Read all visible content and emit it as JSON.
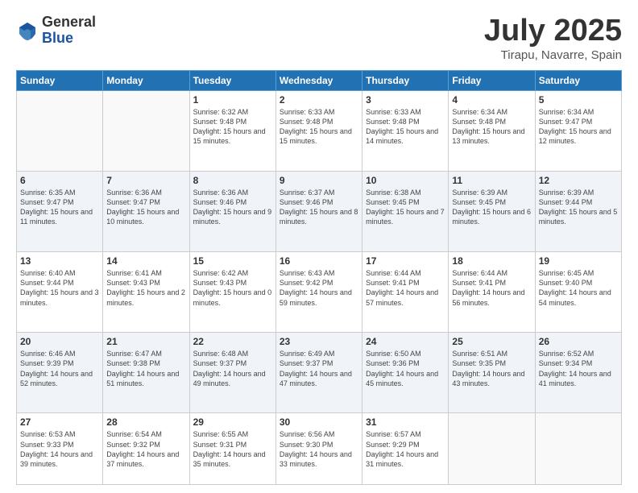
{
  "logo": {
    "general": "General",
    "blue": "Blue"
  },
  "title": "July 2025",
  "subtitle": "Tirapu, Navarre, Spain",
  "weekdays": [
    "Sunday",
    "Monday",
    "Tuesday",
    "Wednesday",
    "Thursday",
    "Friday",
    "Saturday"
  ],
  "weeks": [
    [
      {
        "day": "",
        "sunrise": "",
        "sunset": "",
        "daylight": ""
      },
      {
        "day": "",
        "sunrise": "",
        "sunset": "",
        "daylight": ""
      },
      {
        "day": "1",
        "sunrise": "Sunrise: 6:32 AM",
        "sunset": "Sunset: 9:48 PM",
        "daylight": "Daylight: 15 hours and 15 minutes."
      },
      {
        "day": "2",
        "sunrise": "Sunrise: 6:33 AM",
        "sunset": "Sunset: 9:48 PM",
        "daylight": "Daylight: 15 hours and 15 minutes."
      },
      {
        "day": "3",
        "sunrise": "Sunrise: 6:33 AM",
        "sunset": "Sunset: 9:48 PM",
        "daylight": "Daylight: 15 hours and 14 minutes."
      },
      {
        "day": "4",
        "sunrise": "Sunrise: 6:34 AM",
        "sunset": "Sunset: 9:48 PM",
        "daylight": "Daylight: 15 hours and 13 minutes."
      },
      {
        "day": "5",
        "sunrise": "Sunrise: 6:34 AM",
        "sunset": "Sunset: 9:47 PM",
        "daylight": "Daylight: 15 hours and 12 minutes."
      }
    ],
    [
      {
        "day": "6",
        "sunrise": "Sunrise: 6:35 AM",
        "sunset": "Sunset: 9:47 PM",
        "daylight": "Daylight: 15 hours and 11 minutes."
      },
      {
        "day": "7",
        "sunrise": "Sunrise: 6:36 AM",
        "sunset": "Sunset: 9:47 PM",
        "daylight": "Daylight: 15 hours and 10 minutes."
      },
      {
        "day": "8",
        "sunrise": "Sunrise: 6:36 AM",
        "sunset": "Sunset: 9:46 PM",
        "daylight": "Daylight: 15 hours and 9 minutes."
      },
      {
        "day": "9",
        "sunrise": "Sunrise: 6:37 AM",
        "sunset": "Sunset: 9:46 PM",
        "daylight": "Daylight: 15 hours and 8 minutes."
      },
      {
        "day": "10",
        "sunrise": "Sunrise: 6:38 AM",
        "sunset": "Sunset: 9:45 PM",
        "daylight": "Daylight: 15 hours and 7 minutes."
      },
      {
        "day": "11",
        "sunrise": "Sunrise: 6:39 AM",
        "sunset": "Sunset: 9:45 PM",
        "daylight": "Daylight: 15 hours and 6 minutes."
      },
      {
        "day": "12",
        "sunrise": "Sunrise: 6:39 AM",
        "sunset": "Sunset: 9:44 PM",
        "daylight": "Daylight: 15 hours and 5 minutes."
      }
    ],
    [
      {
        "day": "13",
        "sunrise": "Sunrise: 6:40 AM",
        "sunset": "Sunset: 9:44 PM",
        "daylight": "Daylight: 15 hours and 3 minutes."
      },
      {
        "day": "14",
        "sunrise": "Sunrise: 6:41 AM",
        "sunset": "Sunset: 9:43 PM",
        "daylight": "Daylight: 15 hours and 2 minutes."
      },
      {
        "day": "15",
        "sunrise": "Sunrise: 6:42 AM",
        "sunset": "Sunset: 9:43 PM",
        "daylight": "Daylight: 15 hours and 0 minutes."
      },
      {
        "day": "16",
        "sunrise": "Sunrise: 6:43 AM",
        "sunset": "Sunset: 9:42 PM",
        "daylight": "Daylight: 14 hours and 59 minutes."
      },
      {
        "day": "17",
        "sunrise": "Sunrise: 6:44 AM",
        "sunset": "Sunset: 9:41 PM",
        "daylight": "Daylight: 14 hours and 57 minutes."
      },
      {
        "day": "18",
        "sunrise": "Sunrise: 6:44 AM",
        "sunset": "Sunset: 9:41 PM",
        "daylight": "Daylight: 14 hours and 56 minutes."
      },
      {
        "day": "19",
        "sunrise": "Sunrise: 6:45 AM",
        "sunset": "Sunset: 9:40 PM",
        "daylight": "Daylight: 14 hours and 54 minutes."
      }
    ],
    [
      {
        "day": "20",
        "sunrise": "Sunrise: 6:46 AM",
        "sunset": "Sunset: 9:39 PM",
        "daylight": "Daylight: 14 hours and 52 minutes."
      },
      {
        "day": "21",
        "sunrise": "Sunrise: 6:47 AM",
        "sunset": "Sunset: 9:38 PM",
        "daylight": "Daylight: 14 hours and 51 minutes."
      },
      {
        "day": "22",
        "sunrise": "Sunrise: 6:48 AM",
        "sunset": "Sunset: 9:37 PM",
        "daylight": "Daylight: 14 hours and 49 minutes."
      },
      {
        "day": "23",
        "sunrise": "Sunrise: 6:49 AM",
        "sunset": "Sunset: 9:37 PM",
        "daylight": "Daylight: 14 hours and 47 minutes."
      },
      {
        "day": "24",
        "sunrise": "Sunrise: 6:50 AM",
        "sunset": "Sunset: 9:36 PM",
        "daylight": "Daylight: 14 hours and 45 minutes."
      },
      {
        "day": "25",
        "sunrise": "Sunrise: 6:51 AM",
        "sunset": "Sunset: 9:35 PM",
        "daylight": "Daylight: 14 hours and 43 minutes."
      },
      {
        "day": "26",
        "sunrise": "Sunrise: 6:52 AM",
        "sunset": "Sunset: 9:34 PM",
        "daylight": "Daylight: 14 hours and 41 minutes."
      }
    ],
    [
      {
        "day": "27",
        "sunrise": "Sunrise: 6:53 AM",
        "sunset": "Sunset: 9:33 PM",
        "daylight": "Daylight: 14 hours and 39 minutes."
      },
      {
        "day": "28",
        "sunrise": "Sunrise: 6:54 AM",
        "sunset": "Sunset: 9:32 PM",
        "daylight": "Daylight: 14 hours and 37 minutes."
      },
      {
        "day": "29",
        "sunrise": "Sunrise: 6:55 AM",
        "sunset": "Sunset: 9:31 PM",
        "daylight": "Daylight: 14 hours and 35 minutes."
      },
      {
        "day": "30",
        "sunrise": "Sunrise: 6:56 AM",
        "sunset": "Sunset: 9:30 PM",
        "daylight": "Daylight: 14 hours and 33 minutes."
      },
      {
        "day": "31",
        "sunrise": "Sunrise: 6:57 AM",
        "sunset": "Sunset: 9:29 PM",
        "daylight": "Daylight: 14 hours and 31 minutes."
      },
      {
        "day": "",
        "sunrise": "",
        "sunset": "",
        "daylight": ""
      },
      {
        "day": "",
        "sunrise": "",
        "sunset": "",
        "daylight": ""
      }
    ]
  ]
}
